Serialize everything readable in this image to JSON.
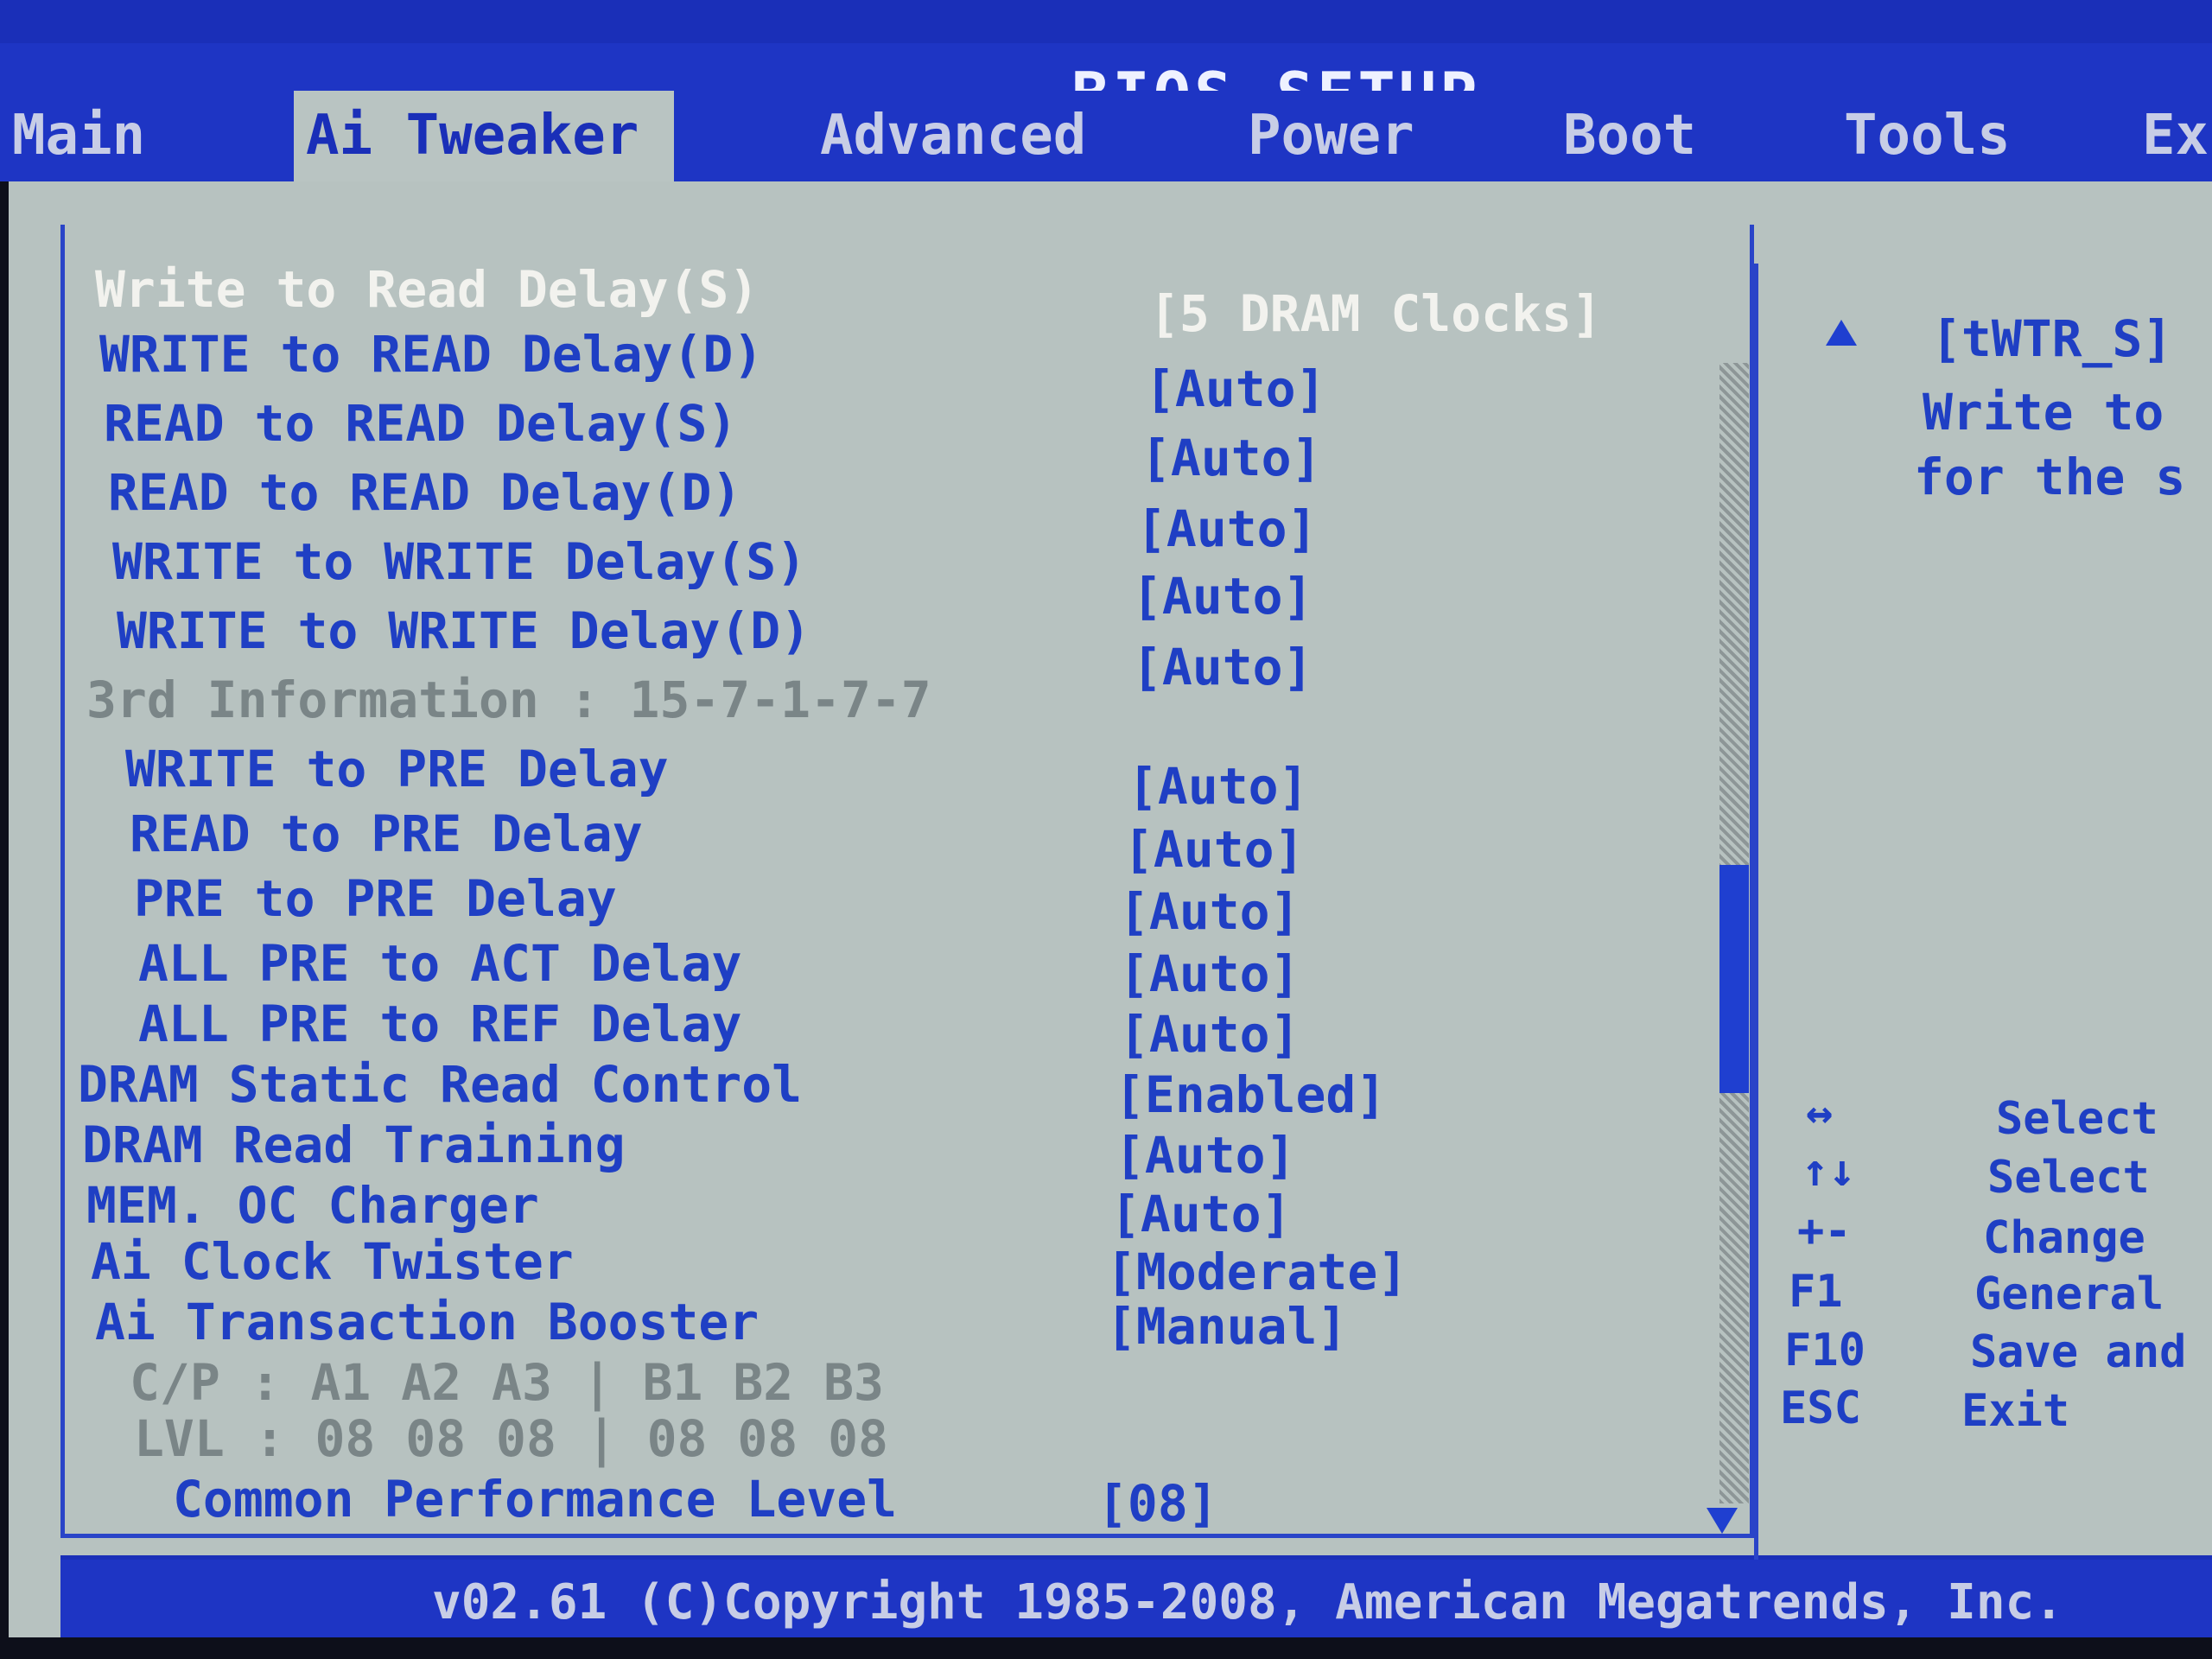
{
  "header": {
    "title": "BIOS SETUP UTILITY"
  },
  "menu": {
    "tabs": [
      {
        "label": "Main"
      },
      {
        "label": "Ai Tweaker"
      },
      {
        "label": "Advanced"
      },
      {
        "label": "Power"
      },
      {
        "label": "Boot"
      },
      {
        "label": "Tools"
      },
      {
        "label": "Ex"
      }
    ]
  },
  "settings": [
    {
      "label": "Write to Read Delay(S)",
      "value": "[5 DRAM Clocks]"
    },
    {
      "label": "WRITE to READ Delay(D)",
      "value": "[Auto]"
    },
    {
      "label": "READ to READ Delay(S)",
      "value": "[Auto]"
    },
    {
      "label": "READ to READ Delay(D)",
      "value": "[Auto]"
    },
    {
      "label": "WRITE to WRITE Delay(S)",
      "value": "[Auto]"
    },
    {
      "label": "WRITE to WRITE Delay(D)",
      "value": "[Auto]"
    },
    {
      "label": "3rd Information : 15-7-1-7-7",
      "value": ""
    },
    {
      "label": "WRITE to PRE Delay",
      "value": "[Auto]"
    },
    {
      "label": "READ to PRE Delay",
      "value": "[Auto]"
    },
    {
      "label": "PRE to PRE Delay",
      "value": "[Auto]"
    },
    {
      "label": "ALL PRE to ACT Delay",
      "value": "[Auto]"
    },
    {
      "label": "ALL PRE to REF Delay",
      "value": "[Auto]"
    },
    {
      "label": "DRAM Static Read Control",
      "value": "[Enabled]"
    },
    {
      "label": "DRAM Read Training",
      "value": "[Auto]"
    },
    {
      "label": "MEM. OC Charger",
      "value": "[Auto]"
    },
    {
      "label": "Ai Clock Twister",
      "value": "[Moderate]"
    },
    {
      "label": "Ai Transaction Booster",
      "value": "[Manual]"
    },
    {
      "label": "C/P : A1 A2 A3 | B1 B2 B3",
      "value": ""
    },
    {
      "label": "LVL : 08 08 08 | 08 08 08",
      "value": ""
    },
    {
      "label": "Common Performance Level",
      "value": "[08]"
    }
  ],
  "help": {
    "lines": [
      "[tWTR_S]",
      "Write to",
      "for the s"
    ]
  },
  "keys": [
    {
      "key": "↔",
      "action": "Select"
    },
    {
      "key": "↑↓",
      "action": "Select"
    },
    {
      "key": "+-",
      "action": "Change"
    },
    {
      "key": "F1",
      "action": "General"
    },
    {
      "key": "F10",
      "action": "Save and"
    },
    {
      "key": "ESC",
      "action": "Exit"
    }
  ],
  "scrollbar": {
    "position": 0.55,
    "visible_fraction": 0.2
  },
  "footer": {
    "copyright": "v02.61 (C)Copyright 1985-2008, American Megatrends, Inc."
  },
  "colors": {
    "accent": "#1e35c4",
    "panel": "#b7c2c0",
    "text": "#1f3fc4",
    "highlight_text": "#f2f2ee",
    "disabled_text": "#7a8587"
  }
}
